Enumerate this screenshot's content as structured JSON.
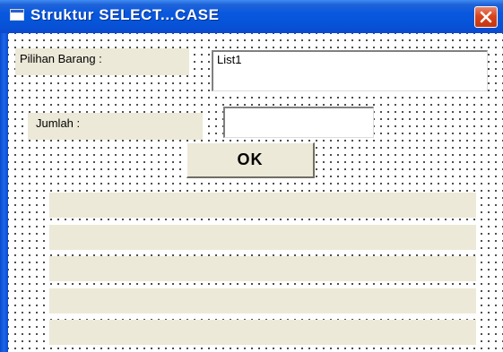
{
  "window": {
    "title": "Struktur SELECT...CASE"
  },
  "form": {
    "label_pilihan": "Pilihan Barang :",
    "listbox_item": "List1",
    "label_jumlah": "Jumlah :",
    "jumlah_value": "",
    "ok_label": "OK",
    "output_labels": [
      "",
      "",
      "",
      "",
      ""
    ]
  },
  "colors": {
    "titlebar": "#0858df",
    "control_face": "#ece9d8",
    "close_button": "#d8451f"
  },
  "icons": [
    "form-icon",
    "close-icon"
  ]
}
